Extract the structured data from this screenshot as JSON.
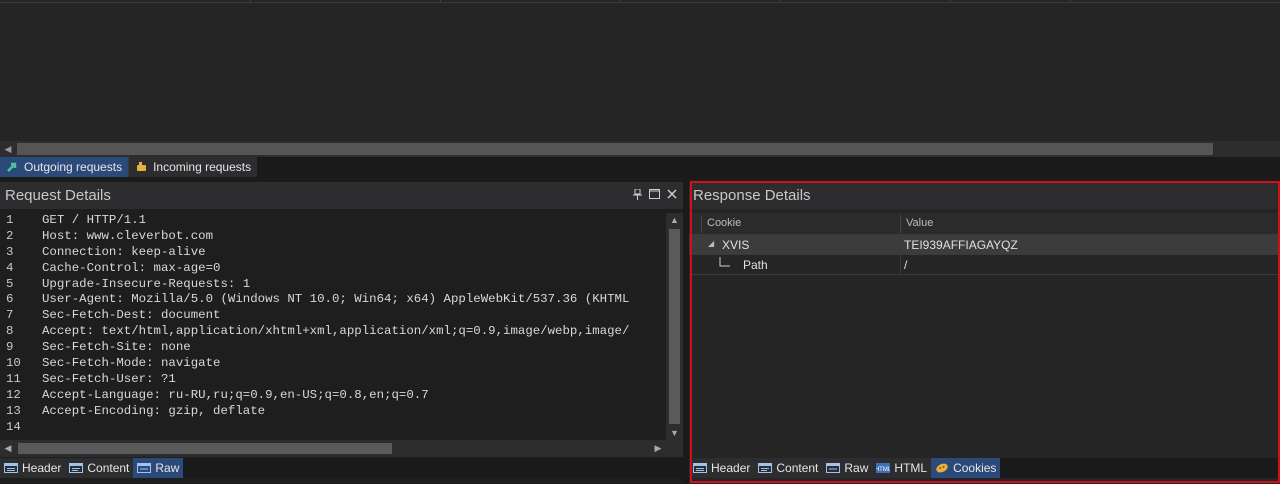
{
  "request_tabs": [
    {
      "label": "Outgoing requests",
      "icon": "outgoing-arrow-icon",
      "active": true
    },
    {
      "label": "Incoming requests",
      "icon": "incoming-hand-icon",
      "active": false
    }
  ],
  "request_details": {
    "title": "Request Details",
    "code_lines": [
      {
        "n": "1",
        "text": "GET / HTTP/1.1"
      },
      {
        "n": "2",
        "text": "Host: www.cleverbot.com"
      },
      {
        "n": "3",
        "text": "Connection: keep-alive"
      },
      {
        "n": "4",
        "text": "Cache-Control: max-age=0"
      },
      {
        "n": "5",
        "text": "Upgrade-Insecure-Requests: 1"
      },
      {
        "n": "6",
        "text": "User-Agent: Mozilla/5.0 (Windows NT 10.0; Win64; x64) AppleWebKit/537.36 (KHTML"
      },
      {
        "n": "7",
        "text": "Sec-Fetch-Dest: document"
      },
      {
        "n": "8",
        "text": "Accept: text/html,application/xhtml+xml,application/xml;q=0.9,image/webp,image/"
      },
      {
        "n": "9",
        "text": "Sec-Fetch-Site: none"
      },
      {
        "n": "10",
        "text": "Sec-Fetch-Mode: navigate"
      },
      {
        "n": "11",
        "text": "Sec-Fetch-User: ?1"
      },
      {
        "n": "12",
        "text": "Accept-Language: ru-RU,ru;q=0.9,en-US;q=0.8,en;q=0.7"
      },
      {
        "n": "13",
        "text": "Accept-Encoding: gzip, deflate"
      },
      {
        "n": "14",
        "text": ""
      }
    ],
    "tabs": [
      {
        "label": "Header",
        "icon": "header-icon",
        "active": false
      },
      {
        "label": "Content",
        "icon": "content-icon",
        "active": false
      },
      {
        "label": "Raw",
        "icon": "raw-icon",
        "active": true
      }
    ]
  },
  "response_details": {
    "title": "Response Details",
    "columns": {
      "cookie": "Cookie",
      "value": "Value"
    },
    "rows": [
      {
        "name": "XVIS",
        "value": "TEI939AFFIAGAYQZ"
      },
      {
        "name": "Path",
        "value": "/"
      }
    ],
    "tabs": [
      {
        "label": "Header",
        "icon": "header-icon",
        "active": false
      },
      {
        "label": "Content",
        "icon": "content-icon",
        "active": false
      },
      {
        "label": "Raw",
        "icon": "raw-icon",
        "active": false
      },
      {
        "label": "HTML",
        "icon": "html-icon",
        "active": false
      },
      {
        "label": "Cookies",
        "icon": "cookie-icon",
        "active": true
      }
    ]
  },
  "colors": {
    "active_tab": "#2b4a7a",
    "highlight": "#d10f17",
    "panel_bg": "#1e1e1e"
  }
}
